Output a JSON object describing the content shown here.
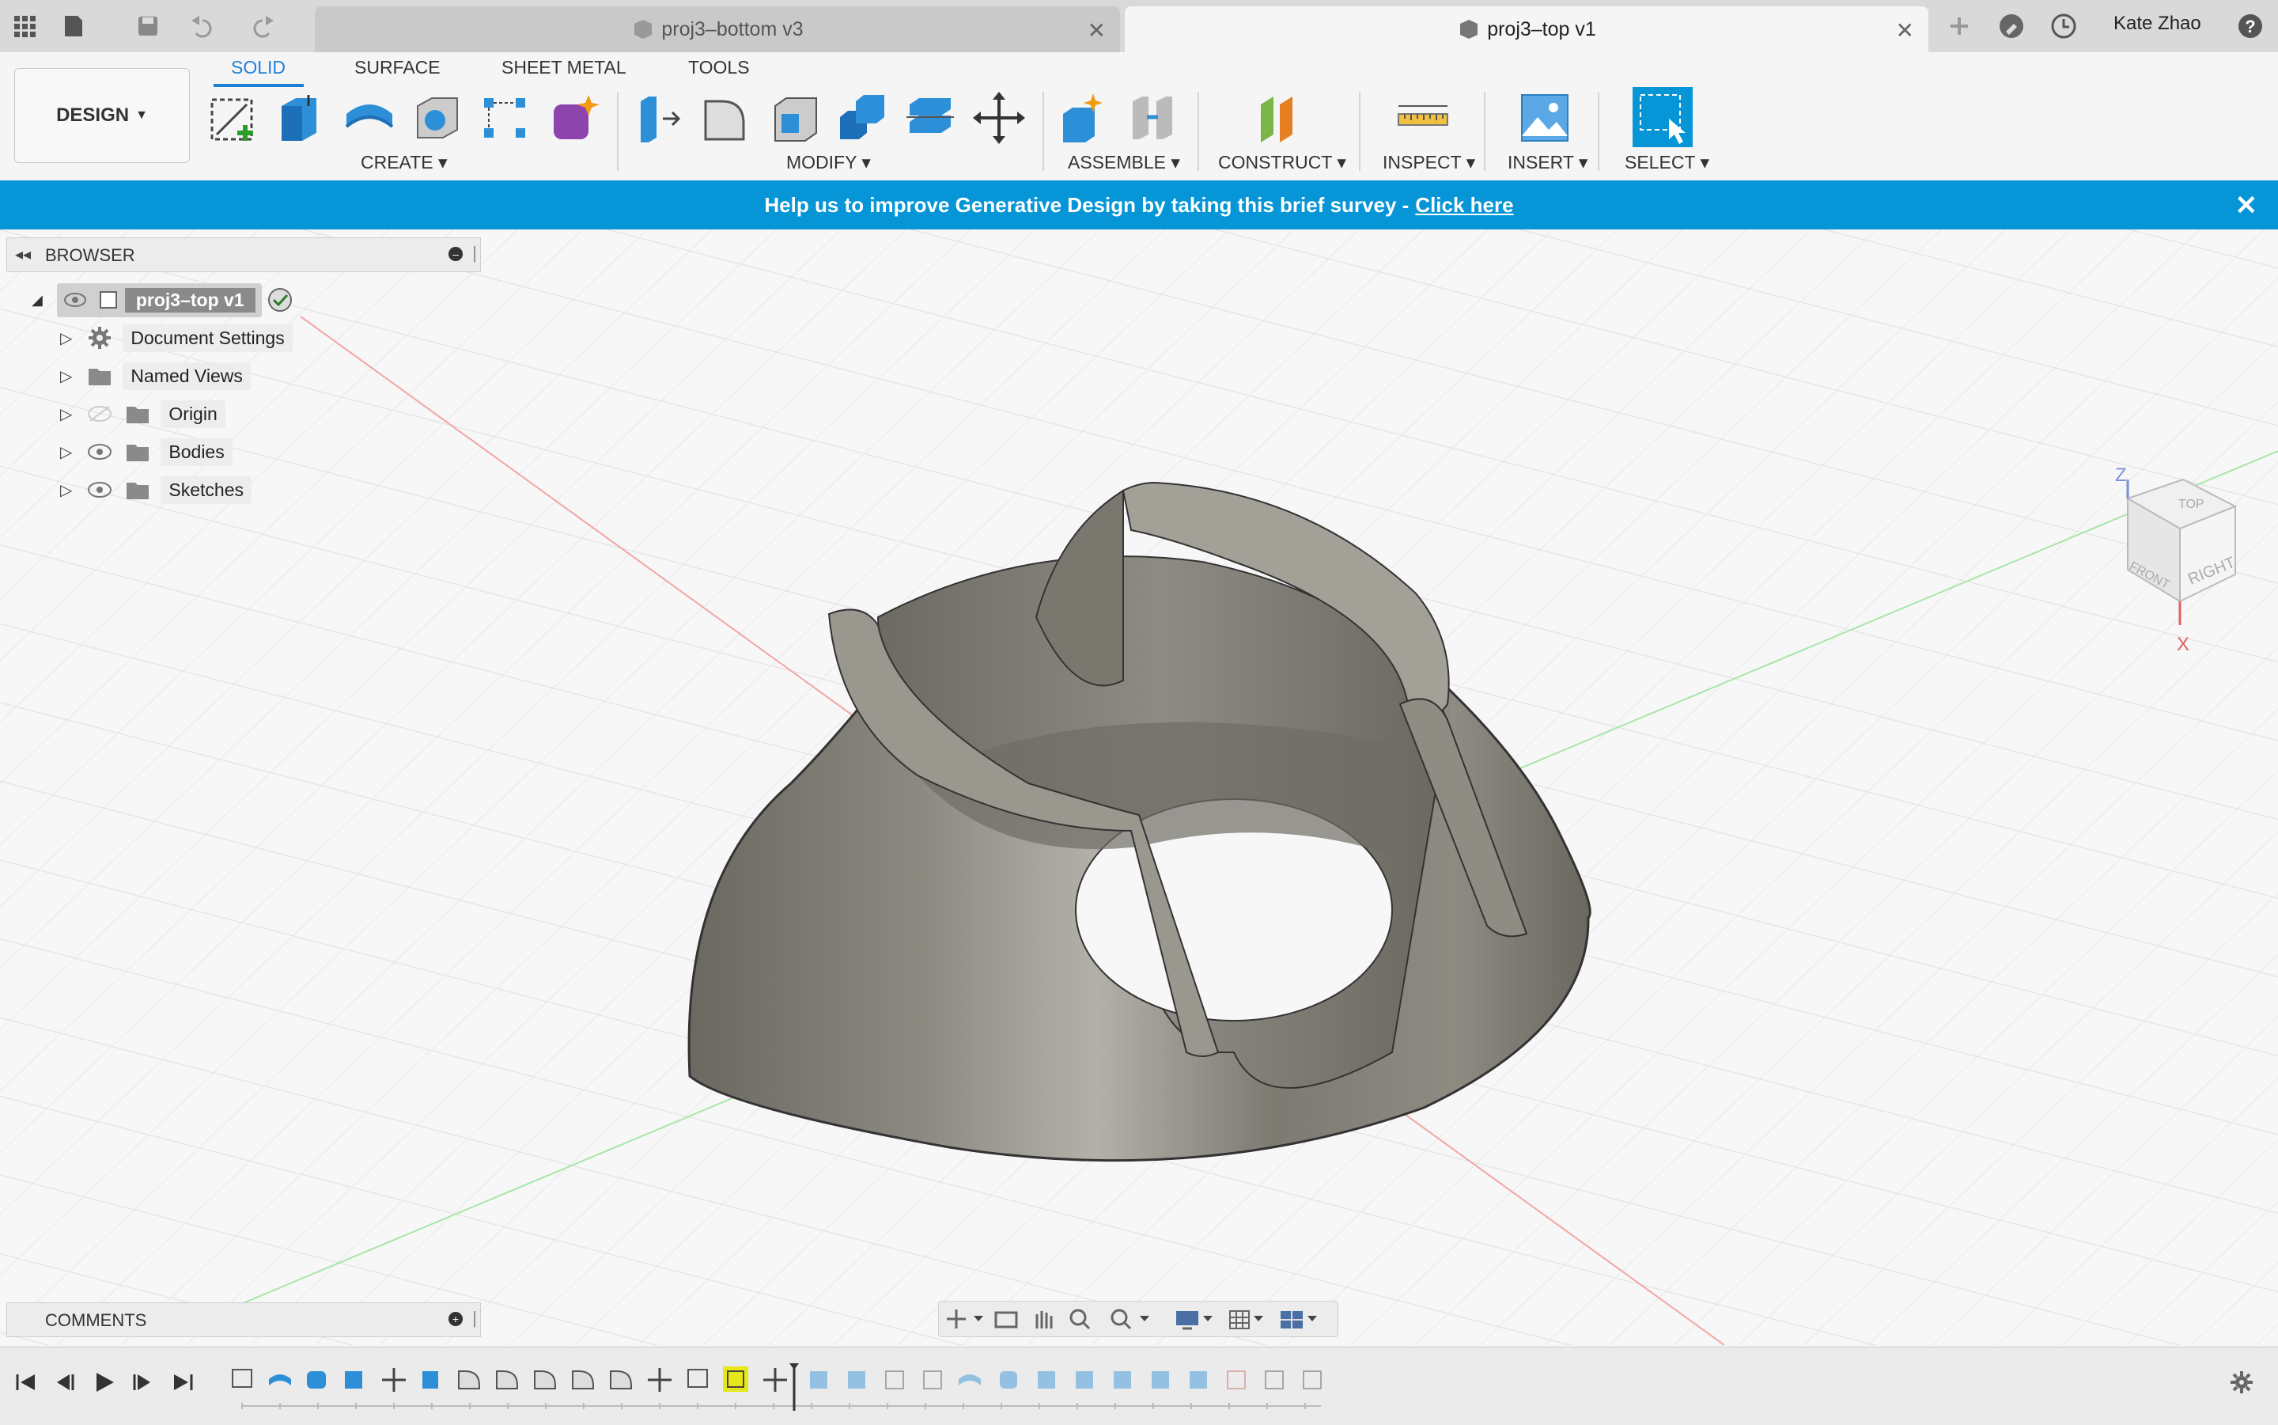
{
  "titlebar": {
    "tabs": [
      {
        "label": "proj3–bottom v3",
        "active": false
      },
      {
        "label": "proj3–top v1",
        "active": true
      }
    ],
    "user": "Kate Zhao"
  },
  "toolbar": {
    "workspace": "DESIGN",
    "tabs": [
      "SOLID",
      "SURFACE",
      "SHEET METAL",
      "TOOLS"
    ],
    "active_tab": "SOLID",
    "groups": [
      "CREATE",
      "MODIFY",
      "ASSEMBLE",
      "CONSTRUCT",
      "INSPECT",
      "INSERT",
      "SELECT"
    ]
  },
  "banner": {
    "message": "Help us to improve Generative Design by taking this brief survey -",
    "link": "Click here"
  },
  "browser": {
    "title": "BROWSER",
    "root": "proj3–top v1",
    "items": [
      "Document Settings",
      "Named Views",
      "Origin",
      "Bodies",
      "Sketches"
    ]
  },
  "comments": {
    "title": "COMMENTS"
  },
  "viewcube": {
    "top": "TOP",
    "front": "FRONT",
    "right": "RIGHT",
    "axis_z": "Z",
    "axis_x": "X"
  },
  "colors": {
    "accent": "#1e7fd6",
    "banner": "#0696d7",
    "select_tool": "#0696d7"
  }
}
